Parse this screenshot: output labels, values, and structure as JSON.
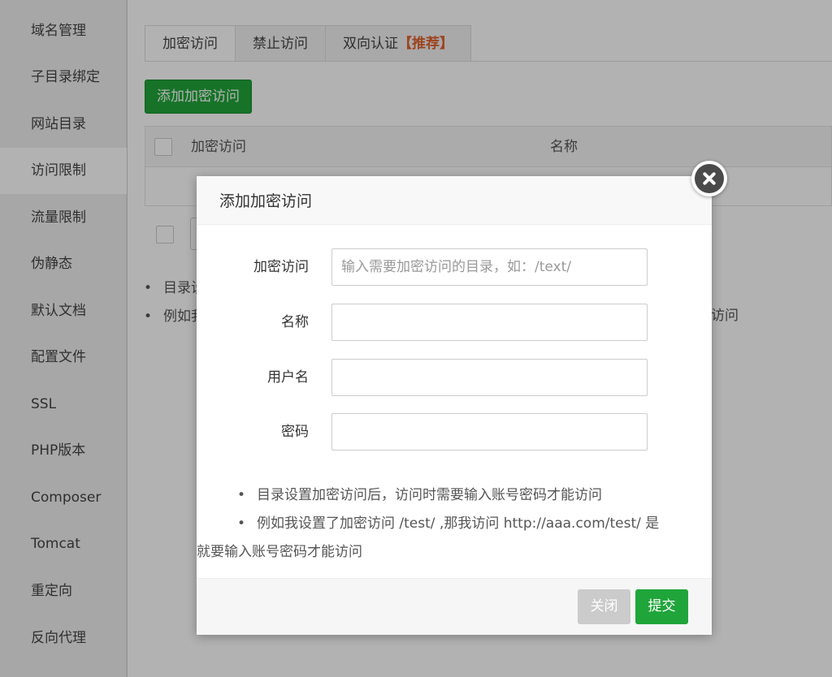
{
  "sidebar": {
    "items": [
      {
        "label": "域名管理"
      },
      {
        "label": "子目录绑定"
      },
      {
        "label": "网站目录"
      },
      {
        "label": "访问限制"
      },
      {
        "label": "流量限制"
      },
      {
        "label": "伪静态"
      },
      {
        "label": "默认文档"
      },
      {
        "label": "配置文件"
      },
      {
        "label": "SSL"
      },
      {
        "label": "PHP版本"
      },
      {
        "label": "Composer"
      },
      {
        "label": "Tomcat"
      },
      {
        "label": "重定向"
      },
      {
        "label": "反向代理"
      }
    ],
    "active_index": 3
  },
  "tabs": {
    "items": [
      {
        "label": "加密访问"
      },
      {
        "label": "禁止访问"
      },
      {
        "label": "双向认证",
        "badge": "【推荐】"
      }
    ],
    "badge_color": "#e2622e"
  },
  "main": {
    "add_button": "添加加密访问",
    "table": {
      "headers": [
        "加密访问",
        "名称"
      ]
    },
    "notes_partial": [
      "目录设",
      "例如我"
    ],
    "right_fragment": "访问"
  },
  "modal": {
    "title": "添加加密访问",
    "fields": [
      {
        "label": "加密访问",
        "value": "",
        "placeholder": "输入需要加密访问的目录，如：/text/"
      },
      {
        "label": "名称",
        "value": "",
        "placeholder": ""
      },
      {
        "label": "用户名",
        "value": "",
        "placeholder": ""
      },
      {
        "label": "密码",
        "value": "",
        "placeholder": ""
      }
    ],
    "notes": [
      "目录设置加密访问后，访问时需要输入账号密码才能访问",
      "例如我设置了加密访问 /test/ ,那我访问 http://aaa.com/test/ 是",
      "就要输入账号密码才能访问"
    ],
    "close_label": "关闭",
    "submit_label": "提交"
  },
  "colors": {
    "accent": "#20a53a",
    "recommend": "#e2622e"
  },
  "icons": {
    "close": "close-icon",
    "bullet": "•"
  }
}
